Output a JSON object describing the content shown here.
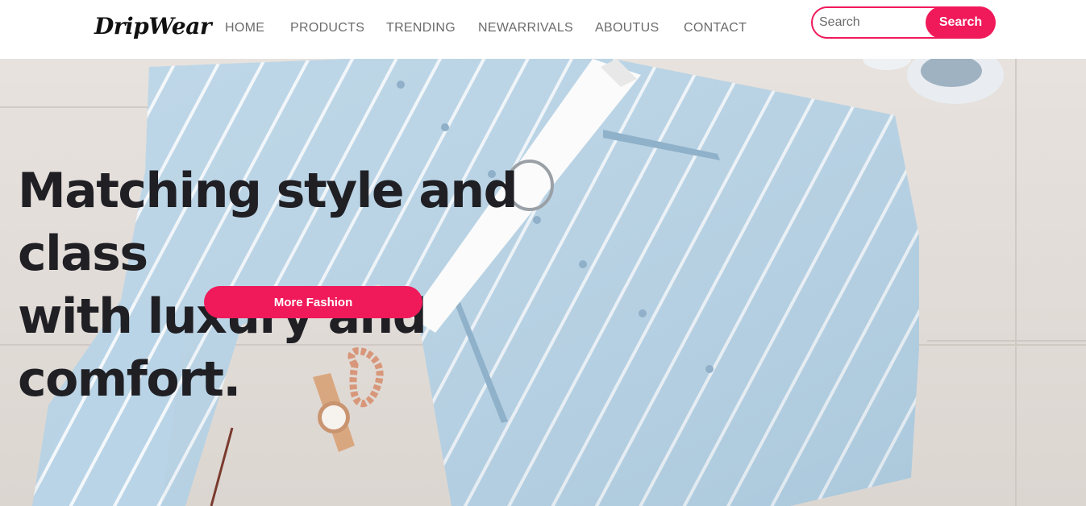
{
  "brand": {
    "name": "DripWear"
  },
  "nav": {
    "items": [
      {
        "label": "HOME"
      },
      {
        "label": "PRODUCTS"
      },
      {
        "label": "TRENDING"
      },
      {
        "label": "NEWARRIVALS"
      },
      {
        "label": "ABOUTUS"
      },
      {
        "label": "CONTACT"
      }
    ]
  },
  "search": {
    "placeholder": "Search",
    "value": "",
    "button_label": "Search"
  },
  "hero": {
    "headline_line1": "Matching style and class",
    "headline_line2": "with luxury and comfort.",
    "cta_label": "More Fashion",
    "image": "striped-shirt-flatlay"
  },
  "colors": {
    "accent": "#f0195a",
    "text_dark": "#1f1f24",
    "nav_text": "#6b6b6b"
  }
}
